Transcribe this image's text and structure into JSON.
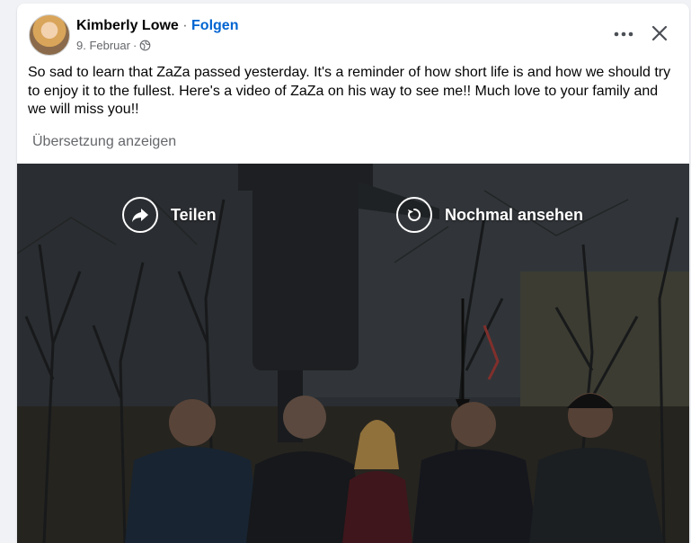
{
  "post": {
    "author": "Kimberly Lowe",
    "separator": " · ",
    "follow_label": "Folgen",
    "date": "9. Februar",
    "meta_separator": " · ",
    "privacy_icon": "globe-icon",
    "text": "So sad to learn that ZaZa passed yesterday. It's a reminder of how short life is and how we should try to enjoy it to the fullest. Here's a video of ZaZa on his way to see me!! Much love to your family and we will miss you!!",
    "see_translation": "Übersetzung anzeigen"
  },
  "header_actions": {
    "more_icon": "more-dots-icon",
    "close_icon": "close-icon"
  },
  "video_overlay": {
    "share_label": "Teilen",
    "share_icon": "share-arrow-icon",
    "replay_label": "Nochmal ansehen",
    "replay_icon": "replay-icon"
  },
  "colors": {
    "accent": "#0064d1",
    "text": "#050505",
    "secondary_text": "#65676b"
  }
}
